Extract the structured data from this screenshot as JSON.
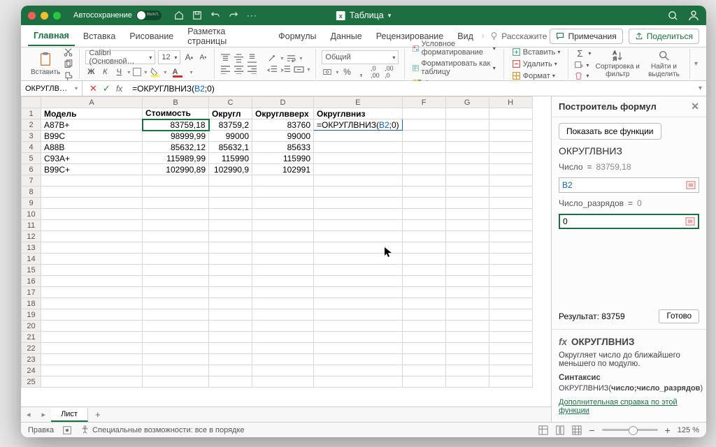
{
  "titlebar": {
    "autosave": "Автосохранение",
    "switch": "выкл.",
    "doc": "Таблица"
  },
  "tabs": {
    "items": [
      "Главная",
      "Вставка",
      "Рисование",
      "Разметка страницы",
      "Формулы",
      "Данные",
      "Рецензирование",
      "Вид"
    ],
    "tell": "Расскажите",
    "comments": "Примечания",
    "share": "Поделиться"
  },
  "ribbon": {
    "paste": "Вставить",
    "font_name": "Calibri (Основной…",
    "font_size": "12",
    "format_general": "Общий",
    "cond": "Условное форматирование",
    "table": "Форматировать как таблицу",
    "styles": "Стили ячеек",
    "insert": "Вставить",
    "delete": "Удалить",
    "formatc": "Формат",
    "sort": "Сортировка и фильтр",
    "find": "Найти и выделить"
  },
  "fbar": {
    "name": "ОКРУГЛВ…",
    "formula_pre": "=ОКРУГЛВНИЗ(",
    "formula_ref": "B2",
    "formula_post": ";0)"
  },
  "sheet": {
    "cols": [
      "A",
      "B",
      "C",
      "D",
      "E",
      "F",
      "G",
      "H"
    ],
    "headers": {
      "A": "Модель",
      "B": "Стоимость",
      "C": "Округл",
      "D": "Округлвверх",
      "E": "Округлвниз"
    },
    "rows": [
      {
        "A": "A87B+",
        "B": "83759,18",
        "C": "83759,2",
        "D": "83760",
        "E_formula_pre": "=ОКРУГЛВНИЗ(",
        "E_ref": "B2",
        "E_post": ";0)"
      },
      {
        "A": "B99C",
        "B": "98999,99",
        "C": "99000",
        "D": "99000"
      },
      {
        "A": "A88B",
        "B": "85632,12",
        "C": "85632,1",
        "D": "85633"
      },
      {
        "A": "C93A+",
        "B": "115989,99",
        "C": "115990",
        "D": "115990"
      },
      {
        "A": "B99C+",
        "B": "102990,89",
        "C": "102990,9",
        "D": "102991"
      }
    ],
    "tab": "Лист"
  },
  "chart_data": {
    "type": "table",
    "columns": [
      "Модель",
      "Стоимость",
      "Округл",
      "Округлвверх",
      "Округлвниз"
    ],
    "rows": [
      [
        "A87B+",
        83759.18,
        83759.2,
        83760,
        null
      ],
      [
        "B99C",
        98999.99,
        99000,
        99000,
        null
      ],
      [
        "A88B",
        85632.12,
        85632.1,
        85633,
        null
      ],
      [
        "C93A+",
        115989.99,
        115990,
        115990,
        null
      ],
      [
        "B99C+",
        102990.89,
        102990.9,
        102991,
        null
      ]
    ]
  },
  "panel": {
    "title": "Построитель формул",
    "show_all": "Показать все функции",
    "fn": "ОКРУГЛВНИЗ",
    "arg1_label": "Число",
    "arg1_eq": "=",
    "arg1_eval": "83759,18",
    "arg1_val": "B2",
    "arg2_label": "Число_разрядов",
    "arg2_eval": "0",
    "arg2_val": "0",
    "result_label": "Результат:",
    "result_val": "83759",
    "done": "Готово",
    "help_fn": "ОКРУГЛВНИЗ",
    "help_desc": "Округляет число до ближайшего меньшего по модулю.",
    "syn_label": "Синтаксис",
    "syn_txt_pre": "ОКРУГЛВНИЗ(",
    "syn_txt_bold": "число;число_разрядов",
    "syn_txt_post": ")",
    "link": "Дополнительная справка по этой функции"
  },
  "status": {
    "mode": "Правка",
    "acc": "Специальные возможности: все в порядке",
    "zoom": "125 %"
  }
}
